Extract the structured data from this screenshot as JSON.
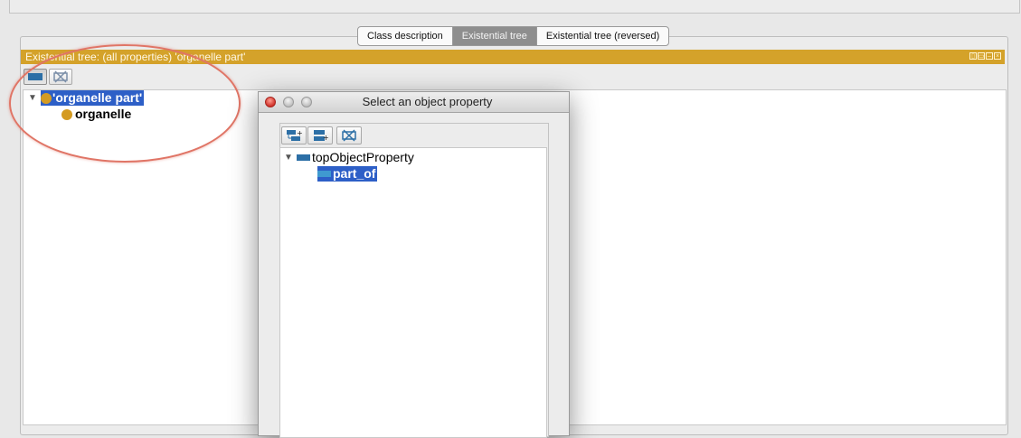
{
  "tabs": [
    {
      "label": "Class description",
      "selected": false
    },
    {
      "label": "Existential tree",
      "selected": true
    },
    {
      "label": "Existential tree (reversed)",
      "selected": false
    }
  ],
  "view": {
    "title": "Existential tree: (all properties) 'organelle part'",
    "header_color": "#d4a22a"
  },
  "toolbar": {
    "property_icon": "object-property-icon",
    "clear_icon": "clear-filter-icon"
  },
  "tree": {
    "root": {
      "label": "'organelle part'",
      "selected": true,
      "icon": "class-icon"
    },
    "children": [
      {
        "label": "organelle",
        "icon": "class-icon"
      }
    ]
  },
  "dialog": {
    "title": "Select an object property",
    "toolbar_icons": [
      "add-subproperty-icon",
      "add-sibling-property-icon",
      "delete-property-icon"
    ],
    "tree": {
      "root": {
        "label": "topObjectProperty",
        "icon": "object-property-icon"
      },
      "children": [
        {
          "label": "part_of",
          "selected": true,
          "icon": "object-property-icon"
        }
      ]
    }
  },
  "annotation": {
    "color": "#e07566"
  }
}
